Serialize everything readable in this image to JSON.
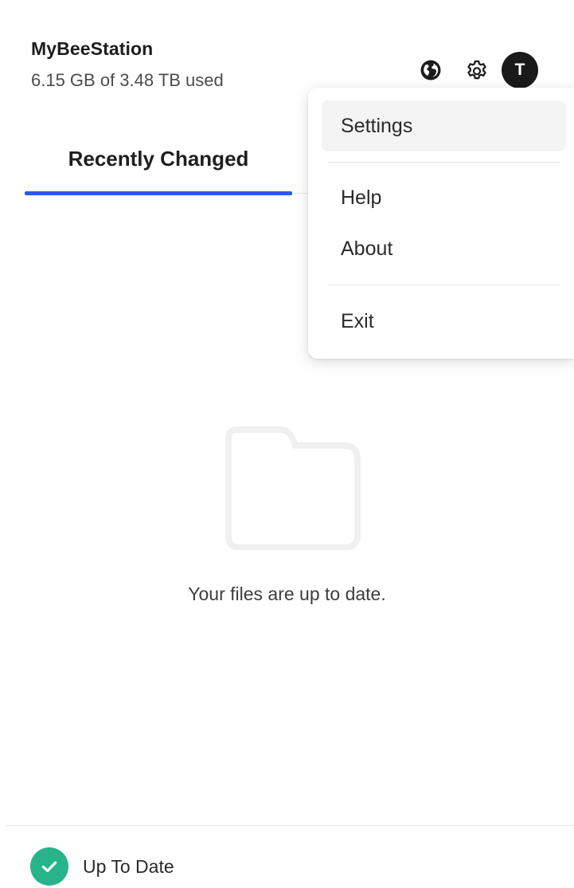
{
  "header": {
    "title": "MyBeeStation",
    "usage": "6.15 GB of 3.48 TB used",
    "icons": [
      "globe-icon",
      "gear-icon"
    ],
    "avatar_letter": "T"
  },
  "tabs": [
    {
      "label": "Recently Changed",
      "active": true
    }
  ],
  "menu": {
    "items": [
      {
        "label": "Settings",
        "highlighted": true
      },
      {
        "label": "Help"
      },
      {
        "label": "About"
      },
      {
        "label": "Exit"
      }
    ]
  },
  "empty_state": {
    "icon": "folder-icon",
    "message": "Your files are up to date."
  },
  "status": {
    "label": "Up To Date",
    "icon": "check-circle-icon",
    "color": "#27b48a"
  },
  "colors": {
    "accent": "#2a5ae8",
    "avatar_bg": "#1a1a1a",
    "status_green": "#27b48a"
  }
}
